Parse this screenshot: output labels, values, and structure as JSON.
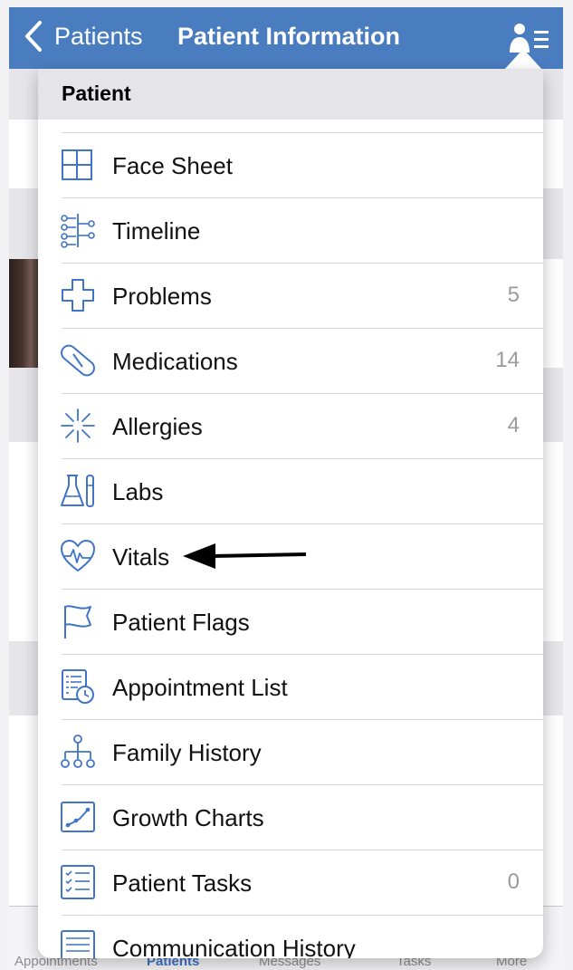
{
  "navbar": {
    "back_label": "Patients",
    "title": "Patient Information"
  },
  "popover": {
    "header": "Patient",
    "items": [
      {
        "label": "Face Sheet",
        "count": "",
        "icon": "grid-icon"
      },
      {
        "label": "Timeline",
        "count": "",
        "icon": "timeline-icon"
      },
      {
        "label": "Problems",
        "count": "5",
        "icon": "cross-icon"
      },
      {
        "label": "Medications",
        "count": "14",
        "icon": "pill-icon"
      },
      {
        "label": "Allergies",
        "count": "4",
        "icon": "allergy-icon"
      },
      {
        "label": "Labs",
        "count": "",
        "icon": "flask-icon"
      },
      {
        "label": "Vitals",
        "count": "",
        "icon": "heart-pulse-icon"
      },
      {
        "label": "Patient Flags",
        "count": "",
        "icon": "flag-icon"
      },
      {
        "label": "Appointment List",
        "count": "",
        "icon": "appointment-icon"
      },
      {
        "label": "Family History",
        "count": "",
        "icon": "family-tree-icon"
      },
      {
        "label": "Growth Charts",
        "count": "",
        "icon": "growth-chart-icon"
      },
      {
        "label": "Patient Tasks",
        "count": "0",
        "icon": "checklist-icon"
      },
      {
        "label": "Communication History",
        "count": "",
        "icon": "communication-icon"
      }
    ]
  },
  "tabbar": {
    "tabs": [
      {
        "label": "Appointments"
      },
      {
        "label": "Patients"
      },
      {
        "label": "Messages"
      },
      {
        "label": "Tasks"
      },
      {
        "label": "More"
      }
    ],
    "active": "Patients"
  },
  "colors": {
    "nav_blue": "#4a7cc0",
    "link_blue": "#3f74c8",
    "icon_blue": "#3f74c8"
  }
}
